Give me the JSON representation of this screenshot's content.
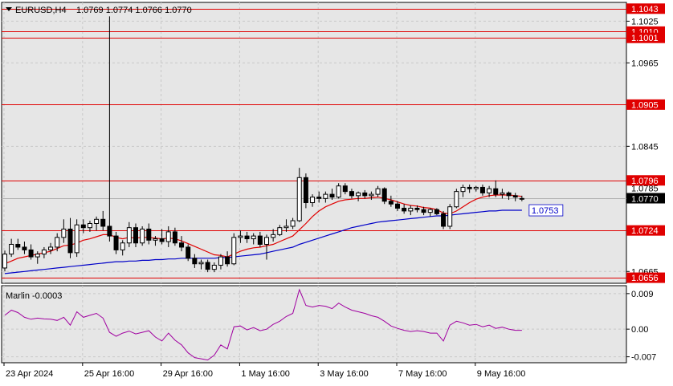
{
  "header": {
    "symbol_timeframe": "EURUSD,H4",
    "ohlc": "1.0769 1.0774 1.0766 1.0770"
  },
  "colors": {
    "background": "#ffffff",
    "plot_background": "#e6e6e6",
    "grid": "#c8c8c8",
    "bull_candle": "#ffffff",
    "bear_candle": "#000000",
    "level_line": "#e00000",
    "ma_fast": "#e00000",
    "ma_slow": "#0000c8",
    "oscillator": "#a000a0",
    "price_label_bg": "#e00000",
    "current_price_bg": "#000000"
  },
  "chart_data": [
    {
      "type": "candlestick",
      "panel": "price",
      "y_range": [
        1.0648,
        1.1052
      ],
      "y_ticks": [
        "1.1025",
        "1.0965",
        "1.0845",
        "1.0665"
      ],
      "x_tick_labels": [
        "23 Apr 2024",
        "25 Apr 16:00",
        "29 Apr 16:00",
        "1 May 16:00",
        "3 May 16:00",
        "7 May 16:00",
        "9 May 16:00"
      ],
      "horizontal_levels": [
        {
          "label": "1.1043",
          "value": 1.1043
        },
        {
          "label": "1.1010",
          "value": 1.101
        },
        {
          "label": "1.1001",
          "value": 1.1001
        },
        {
          "label": "1.0905",
          "value": 1.0905
        },
        {
          "label": "1.0796",
          "value": 1.0796
        },
        {
          "label": "1.0724",
          "value": 1.0724
        },
        {
          "label": "1.0656",
          "value": 1.0656
        }
      ],
      "current_price": {
        "label": "1.0770",
        "value": 1.077
      },
      "ma_slow_label": {
        "label": "1.0753",
        "value": 1.0753
      },
      "partial_tick_label": "1.0785",
      "candles": [
        [
          1.067,
          1.0695,
          1.0665,
          1.069
        ],
        [
          1.069,
          1.0712,
          1.0686,
          1.0704
        ],
        [
          1.0704,
          1.0712,
          1.0696,
          1.07
        ],
        [
          1.07,
          1.0708,
          1.069,
          1.0696
        ],
        [
          1.0696,
          1.0704,
          1.0682,
          1.0686
        ],
        [
          1.0686,
          1.0694,
          1.0676,
          1.069
        ],
        [
          1.069,
          1.07,
          1.0684,
          1.0696
        ],
        [
          1.0696,
          1.0706,
          1.069,
          1.07
        ],
        [
          1.07,
          1.072,
          1.0694,
          1.0714
        ],
        [
          1.0714,
          1.074,
          1.0706,
          1.0726
        ],
        [
          1.0726,
          1.0742,
          1.0684,
          1.0692
        ],
        [
          1.0692,
          1.074,
          1.0686,
          1.0732
        ],
        [
          1.0732,
          1.074,
          1.072,
          1.0728
        ],
        [
          1.0728,
          1.0738,
          1.0722,
          1.0734
        ],
        [
          1.0734,
          1.0744,
          1.0724,
          1.074
        ],
        [
          1.074,
          1.0752,
          1.0724,
          1.073
        ],
        [
          1.073,
          1.1032,
          1.0708,
          1.0716
        ],
        [
          1.0716,
          1.0722,
          1.069,
          1.0696
        ],
        [
          1.0696,
          1.071,
          1.0688,
          1.0706
        ],
        [
          1.0706,
          1.0736,
          1.07,
          1.0728
        ],
        [
          1.0728,
          1.0734,
          1.07,
          1.0706
        ],
        [
          1.0706,
          1.073,
          1.0702,
          1.0726
        ],
        [
          1.0726,
          1.0734,
          1.0704,
          1.071
        ],
        [
          1.071,
          1.0716,
          1.0702,
          1.0712
        ],
        [
          1.0712,
          1.0726,
          1.0704,
          1.0708
        ],
        [
          1.0708,
          1.073,
          1.07,
          1.0722
        ],
        [
          1.0722,
          1.0728,
          1.0702,
          1.0706
        ],
        [
          1.0706,
          1.0716,
          1.0694,
          1.07
        ],
        [
          1.07,
          1.0704,
          1.068,
          1.0684
        ],
        [
          1.0684,
          1.069,
          1.067,
          1.0676
        ],
        [
          1.0676,
          1.0682,
          1.0668,
          1.0678
        ],
        [
          1.0678,
          1.0682,
          1.0664,
          1.0668
        ],
        [
          1.0668,
          1.0678,
          1.0664,
          1.0674
        ],
        [
          1.0674,
          1.069,
          1.0668,
          1.0686
        ],
        [
          1.0686,
          1.0694,
          1.0672,
          1.0676
        ],
        [
          1.0676,
          1.072,
          1.0674,
          1.0714
        ],
        [
          1.0714,
          1.0724,
          1.0706,
          1.0716
        ],
        [
          1.0716,
          1.0722,
          1.0706,
          1.0712
        ],
        [
          1.0712,
          1.072,
          1.0704,
          1.0716
        ],
        [
          1.0716,
          1.0722,
          1.07,
          1.0704
        ],
        [
          1.0704,
          1.0718,
          1.0682,
          1.0714
        ],
        [
          1.0714,
          1.0726,
          1.0708,
          1.0718
        ],
        [
          1.0718,
          1.0732,
          1.0716,
          1.0728
        ],
        [
          1.0728,
          1.074,
          1.0722,
          1.073
        ],
        [
          1.073,
          1.0742,
          1.0726,
          1.0738
        ],
        [
          1.0738,
          1.0814,
          1.0736,
          1.08
        ],
        [
          1.08,
          1.0806,
          1.0756,
          1.0764
        ],
        [
          1.0764,
          1.0776,
          1.0758,
          1.0772
        ],
        [
          1.0772,
          1.078,
          1.0764,
          1.077
        ],
        [
          1.077,
          1.078,
          1.0764,
          1.0776
        ],
        [
          1.0776,
          1.0784,
          1.0768,
          1.0772
        ],
        [
          1.0772,
          1.0792,
          1.077,
          1.0788
        ],
        [
          1.0788,
          1.0792,
          1.0776,
          1.078
        ],
        [
          1.078,
          1.0784,
          1.077,
          1.0774
        ],
        [
          1.0774,
          1.078,
          1.0766,
          1.0778
        ],
        [
          1.0778,
          1.0782,
          1.077,
          1.0774
        ],
        [
          1.0774,
          1.078,
          1.0768,
          1.0776
        ],
        [
          1.0776,
          1.0788,
          1.0772,
          1.0784
        ],
        [
          1.0784,
          1.0786,
          1.0762,
          1.0766
        ],
        [
          1.0766,
          1.0774,
          1.0758,
          1.0762
        ],
        [
          1.0762,
          1.0766,
          1.0752,
          1.0756
        ],
        [
          1.0756,
          1.0762,
          1.0748,
          1.0752
        ],
        [
          1.0752,
          1.076,
          1.0746,
          1.0756
        ],
        [
          1.0756,
          1.076,
          1.075,
          1.0754
        ],
        [
          1.0754,
          1.0758,
          1.0746,
          1.075
        ],
        [
          1.075,
          1.0756,
          1.0744,
          1.0754
        ],
        [
          1.0754,
          1.0756,
          1.0746,
          1.0748
        ],
        [
          1.0748,
          1.0752,
          1.0726,
          1.073
        ],
        [
          1.073,
          1.0762,
          1.0726,
          1.0758
        ],
        [
          1.0758,
          1.0784,
          1.0756,
          1.078
        ],
        [
          1.078,
          1.079,
          1.0772,
          1.0786
        ],
        [
          1.0786,
          1.079,
          1.0778,
          1.0784
        ],
        [
          1.0784,
          1.0788,
          1.078,
          1.0786
        ],
        [
          1.0786,
          1.079,
          1.0774,
          1.0778
        ],
        [
          1.0778,
          1.0788,
          1.0772,
          1.0784
        ],
        [
          1.0784,
          1.0796,
          1.0772,
          1.0776
        ],
        [
          1.0776,
          1.0784,
          1.077,
          1.0778
        ],
        [
          1.0778,
          1.078,
          1.0768,
          1.0774
        ],
        [
          1.0774,
          1.0778,
          1.0766,
          1.0772
        ],
        [
          1.0769,
          1.0774,
          1.0766,
          1.077
        ]
      ],
      "ma_fast": [
        1.0676,
        1.068,
        1.0684,
        1.0686,
        1.0688,
        1.069,
        1.0692,
        1.0694,
        1.0698,
        1.0702,
        1.0703,
        1.0706,
        1.071,
        1.0712,
        1.0715,
        1.0718,
        1.0718,
        1.0714,
        1.0712,
        1.0714,
        1.0713,
        1.0714,
        1.0714,
        1.0713,
        1.0712,
        1.0713,
        1.0712,
        1.0709,
        1.0705,
        1.0701,
        1.0697,
        1.0693,
        1.0689,
        1.0688,
        1.0686,
        1.069,
        1.0694,
        1.0697,
        1.0699,
        1.07,
        1.0702,
        1.0704,
        1.0708,
        1.0712,
        1.0716,
        1.0725,
        1.0734,
        1.0744,
        1.0752,
        1.0758,
        1.0762,
        1.0766,
        1.0768,
        1.0769,
        1.077,
        1.077,
        1.0771,
        1.0772,
        1.077,
        1.0768,
        1.0765,
        1.0762,
        1.076,
        1.0759,
        1.0757,
        1.0756,
        1.0754,
        1.0749,
        1.0748,
        1.0752,
        1.0758,
        1.0764,
        1.0769,
        1.0772,
        1.0774,
        1.0775,
        1.0775,
        1.0775,
        1.0774,
        1.0773
      ],
      "ma_slow": [
        1.0662,
        1.0663,
        1.0664,
        1.0665,
        1.0666,
        1.0667,
        1.0668,
        1.0669,
        1.067,
        1.0671,
        1.0672,
        1.0673,
        1.0674,
        1.0675,
        1.0676,
        1.0677,
        1.0678,
        1.0679,
        1.0679,
        1.068,
        1.068,
        1.0681,
        1.0681,
        1.0682,
        1.0682,
        1.0683,
        1.0683,
        1.0684,
        1.0684,
        1.0684,
        1.0684,
        1.0684,
        1.0684,
        1.0685,
        1.0685,
        1.0686,
        1.0687,
        1.0688,
        1.0689,
        1.069,
        1.0692,
        1.0694,
        1.0696,
        1.0698,
        1.07,
        1.0704,
        1.0707,
        1.071,
        1.0713,
        1.0716,
        1.0719,
        1.0722,
        1.0725,
        1.0728,
        1.073,
        1.0732,
        1.0734,
        1.0736,
        1.0737,
        1.0738,
        1.0739,
        1.074,
        1.0741,
        1.0742,
        1.0743,
        1.0744,
        1.0745,
        1.0745,
        1.0746,
        1.0747,
        1.0748,
        1.0749,
        1.075,
        1.0751,
        1.0752,
        1.0752,
        1.0753,
        1.0753,
        1.0753,
        1.0753
      ]
    },
    {
      "type": "line",
      "panel": "oscillator",
      "title": "Marlin -0.0003",
      "y_range": [
        -0.0085,
        0.011
      ],
      "y_ticks": [
        "0.009",
        "0.00",
        "-0.007"
      ],
      "values": [
        0.0035,
        0.0048,
        0.0042,
        0.003,
        0.0025,
        0.0028,
        0.0026,
        0.0025,
        0.0022,
        0.003,
        0.001,
        0.0044,
        0.003,
        0.0035,
        0.004,
        0.0028,
        -0.0008,
        -0.0018,
        -0.001,
        -0.0005,
        -0.0012,
        -0.0008,
        -0.0004,
        -0.002,
        -0.003,
        -0.001,
        -0.0028,
        -0.004,
        -0.006,
        -0.0072,
        -0.0075,
        -0.0078,
        -0.0066,
        -0.004,
        -0.005,
        0.0006,
        0.0008,
        -0.0002,
        0.0004,
        -0.0004,
        0.0,
        0.0012,
        0.002,
        0.0032,
        0.004,
        0.01,
        0.006,
        0.0056,
        0.006,
        0.0058,
        0.0052,
        0.0066,
        0.0056,
        0.0048,
        0.0044,
        0.004,
        0.0034,
        0.003,
        0.002,
        0.0008,
        0.0002,
        -0.0003,
        -0.0006,
        -0.0004,
        -0.0006,
        -0.001,
        -0.001,
        -0.003,
        0.001,
        0.002,
        0.0016,
        0.001,
        0.0012,
        0.0006,
        0.001,
        0.0002,
        0.0005,
        0.0,
        -0.0003,
        -0.0003
      ]
    }
  ]
}
